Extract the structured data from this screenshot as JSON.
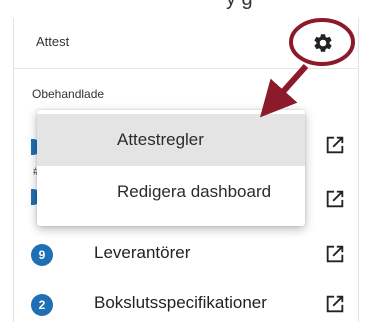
{
  "top_partial_text": "y g",
  "card": {
    "title": "Attest",
    "section_label": "Obehandlade",
    "settings_icon": "gear-icon"
  },
  "menu": {
    "items": [
      {
        "label": "Attestregler",
        "active": true
      },
      {
        "label": "Redigera dashboard",
        "active": false
      }
    ]
  },
  "rows": [
    {
      "count": "9",
      "label": "Leverantörer",
      "icon": "external-link-icon"
    },
    {
      "count": "2",
      "label": "Bokslutsspecifikationer",
      "icon": "external-link-icon"
    }
  ],
  "hidden_marker": "#",
  "colors": {
    "badge": "#1f6fb4",
    "annotation": "#8b1a2b",
    "menu_active_bg": "#e4e4e4"
  }
}
